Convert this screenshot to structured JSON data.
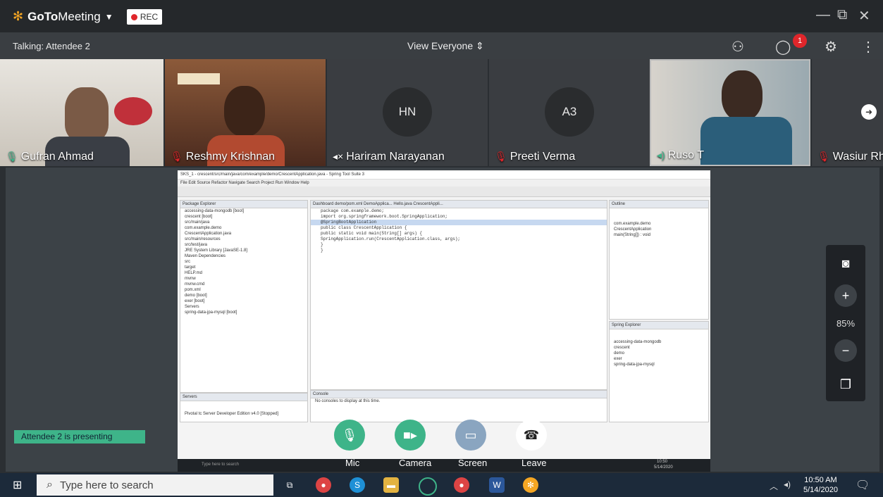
{
  "app": {
    "name_bold": "GoTo",
    "name_rest": "Meeting",
    "rec_label": "REC"
  },
  "status": {
    "talking": "Talking: Attendee 2",
    "view": "View Everyone",
    "chat_badge": "1"
  },
  "tiles": [
    {
      "name": "Gufran Ahmad",
      "initials": ""
    },
    {
      "name": "Reshmy Krishnan",
      "initials": ""
    },
    {
      "name": "Hariram Narayanan",
      "initials": "HN"
    },
    {
      "name": "Preeti Verma",
      "initials": "A3"
    },
    {
      "name": "Ruso T",
      "initials": ""
    },
    {
      "name": "Wasiur Rh",
      "initials": ""
    }
  ],
  "zoom": {
    "level": "85%"
  },
  "presenting": "Attendee 2 is presenting",
  "controls": {
    "mic": "Mic",
    "camera": "Camera",
    "screen": "Screen",
    "leave": "Leave"
  },
  "shared": {
    "title": "SKS_1 - crescent/src/main/java/com/example/demo/CrescentApplication.java - Spring Tool Suite 3",
    "menu": "File  Edit  Source  Refactor  Navigate  Search  Project  Run  Window  Help",
    "explorer_title": "Package Explorer",
    "explorer_items": [
      "accessing-data-mongodb [boot]",
      "crescent [boot]",
      "src/main/java",
      "com.example.demo",
      "CrescentApplication.java",
      "src/main/resources",
      "src/test/java",
      "JRE System Library [JavaSE-1.8]",
      "Maven Dependencies",
      "src",
      "target",
      "HELP.md",
      "mvnw",
      "mvnw.cmd",
      "pom.xml",
      "demo [boot]",
      "exer [boot]",
      "Servers",
      "spring-data-jpa-mysql [boot]"
    ],
    "tabs": "Dashboard   demo/pom.xml   DemoApplica...   Hello.java   CrescentAppli...",
    "code": [
      "package com.example.demo;",
      "",
      "import org.springframework.boot.SpringApplication;",
      "",
      "@SpringBootApplication",
      "public class CrescentApplication {",
      "",
      "    public static void main(String[] args) {",
      "        SpringApplication.run(CrescentApplication.class, args);",
      "    }",
      "",
      "}"
    ],
    "outline_title": "Outline",
    "outline_items": [
      "com.example.demo",
      "CrescentApplication",
      "main(String[]) : void"
    ],
    "spring_title": "Spring Explorer",
    "spring_items": [
      "accessing-data-mongodb",
      "crescent",
      "demo",
      "exer",
      "spring-data-jpa-mysql"
    ],
    "console_title": "Console",
    "console_text": "No consoles to display at this time.",
    "servers_title": "Servers",
    "server_item": "Pivotal tc Server Developer Edition v4.0 [Stopped]",
    "search_in": "Type here to search",
    "time_in": "10:50",
    "date_in": "5/14/2020"
  },
  "taskbar": {
    "search": "Type here to search",
    "time": "10:50 AM",
    "date": "5/14/2020"
  }
}
